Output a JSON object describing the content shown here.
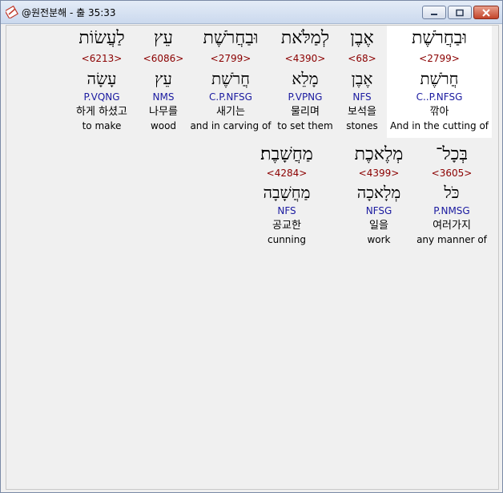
{
  "window": {
    "title": "@원전분해 - 출 35:33"
  },
  "colors": {
    "strong_number": "#8b0000",
    "morphology": "#1a1aa0",
    "highlight": "#ffffff"
  },
  "row1": [
    {
      "hebrew": "וּבַחֲרֹשֶׁת",
      "strong": "<2799>",
      "lexeme": "חֲרֹשֶׁת",
      "morph": "C..P.NFSG",
      "korean": "깎아",
      "english": "And in the cutting of"
    },
    {
      "hebrew": "אֶבֶן",
      "strong": "<68>",
      "lexeme": "אֶבֶן",
      "morph": "NFS",
      "korean": "보석을",
      "english": "stones"
    },
    {
      "hebrew": "לְמַלֹּאת",
      "strong": "<4390>",
      "lexeme": "מָלֵא",
      "morph": "P.VPNG",
      "korean": "물리며",
      "english": "to set them"
    },
    {
      "hebrew": "וּבַחֲרֹשֶׁת",
      "strong": "<2799>",
      "lexeme": "חֲרֹשֶׁת",
      "morph": "C.P.NFSG",
      "korean": "새기는",
      "english": "and in carving of"
    },
    {
      "hebrew": "עֵץ",
      "strong": "<6086>",
      "lexeme": "עֵץ",
      "morph": "NMS",
      "korean": "나무를",
      "english": "wood"
    },
    {
      "hebrew": "לַעֲשׂוֹת",
      "strong": "<6213>",
      "lexeme": "עָשָׂה",
      "morph": "P.VQNG",
      "korean": "하게 하셨고",
      "english": "to make"
    }
  ],
  "row2": [
    {
      "hebrew": "בְּכָל־",
      "strong": "<3605>",
      "lexeme": "כֹּל",
      "morph": "P.NMSG",
      "korean": "여러가지",
      "english": "any manner of"
    },
    {
      "hebrew": "מְלֶאכֶת",
      "strong": "<4399>",
      "lexeme": "מְלָאכָה",
      "morph": "NFSG",
      "korean": "일을",
      "english": "work"
    },
    {
      "hebrew": "מַחֲשָׁבֶת׃",
      "strong": "<4284>",
      "lexeme": "מַחֲשָׁבָה",
      "morph": "NFS",
      "korean": "공교한",
      "english": "cunning"
    }
  ]
}
